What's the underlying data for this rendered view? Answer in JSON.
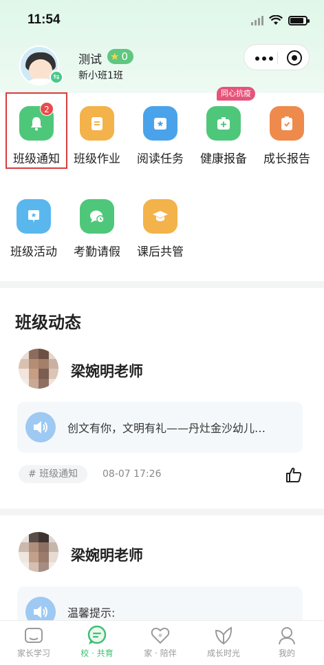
{
  "status_bar": {
    "time": "11:54"
  },
  "profile": {
    "name": "测试",
    "points": "0",
    "class_name": "新小班1班",
    "switch_icon": "swap-icon"
  },
  "colors": {
    "brand_green": "#3fbf72",
    "notify_red": "#e84b4b",
    "tag_pink": "#e6547a"
  },
  "grid": {
    "row1": [
      {
        "label": "班级通知",
        "icon": "bell-icon",
        "badge": "2",
        "color": "#4fc77a"
      },
      {
        "label": "班级作业",
        "icon": "homework-icon",
        "color": "#f3b24a"
      },
      {
        "label": "阅读任务",
        "icon": "reading-icon",
        "color": "#4aa3ea"
      },
      {
        "label": "健康报备",
        "icon": "medical-kit-icon",
        "color": "#4fc77a",
        "tag": "同心抗疫"
      },
      {
        "label": "成长报告",
        "icon": "clipboard-icon",
        "color": "#ee8a4c"
      }
    ],
    "row2": [
      {
        "label": "班级活动",
        "icon": "activity-icon",
        "color": "#5ab7ee"
      },
      {
        "label": "考勤请假",
        "icon": "chat-clock-icon",
        "color": "#4fc77a"
      },
      {
        "label": "课后共管",
        "icon": "graduation-cap-icon",
        "color": "#f3b24a"
      }
    ]
  },
  "feed": {
    "title": "班级动态",
    "posts": [
      {
        "teacher": "梁婉明老师",
        "content": "创文有你，文明有礼——丹灶金沙幼儿…",
        "tag": "# 班级通知",
        "time": "08-07 17:26"
      },
      {
        "teacher": "梁婉明老师",
        "content": "温馨提示:"
      }
    ]
  },
  "tabbar": {
    "items": [
      {
        "label": "家长学习",
        "icon": "classroom-icon",
        "active": false
      },
      {
        "label": "校 · 共育",
        "icon": "chat-bubble-icon",
        "active": true
      },
      {
        "label": "家 · 陪伴",
        "icon": "heart-icon",
        "active": false
      },
      {
        "label": "成长时光",
        "icon": "leaf-icon",
        "active": false
      },
      {
        "label": "我的",
        "icon": "user-icon",
        "active": false
      }
    ]
  }
}
